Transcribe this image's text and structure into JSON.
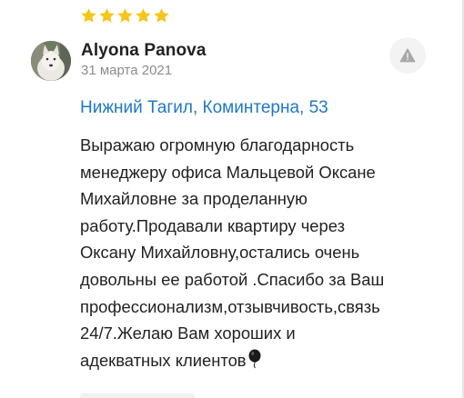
{
  "review": {
    "rating": 5,
    "rating_max": 5,
    "author": "Alyona Panova",
    "date": "31 марта 2021",
    "address": "Нижний Тагил, Коминтерна, 53",
    "text": "Выражаю огромную благодарность\nменеджеру офиса Мальцевой Оксане\nМихайловне за проделанную\nработу.Продавали квартиру через\nОксану Михайловну,остались очень\nдовольны ее работой .Спасибо за Ваш\nпрофессионализм,отзывчивость,связь\n24/7.Желаю Вам хороших и\nадекватных клиентов"
  },
  "icons": {
    "star": "star-icon",
    "report": "warning-icon",
    "emoji": "balloon-icon"
  },
  "colors": {
    "star": "#f5c518",
    "link": "#1f78c4",
    "date": "#8c8c8c",
    "report_bg": "#f3f3f3",
    "report_icon": "#a8a8a8"
  }
}
